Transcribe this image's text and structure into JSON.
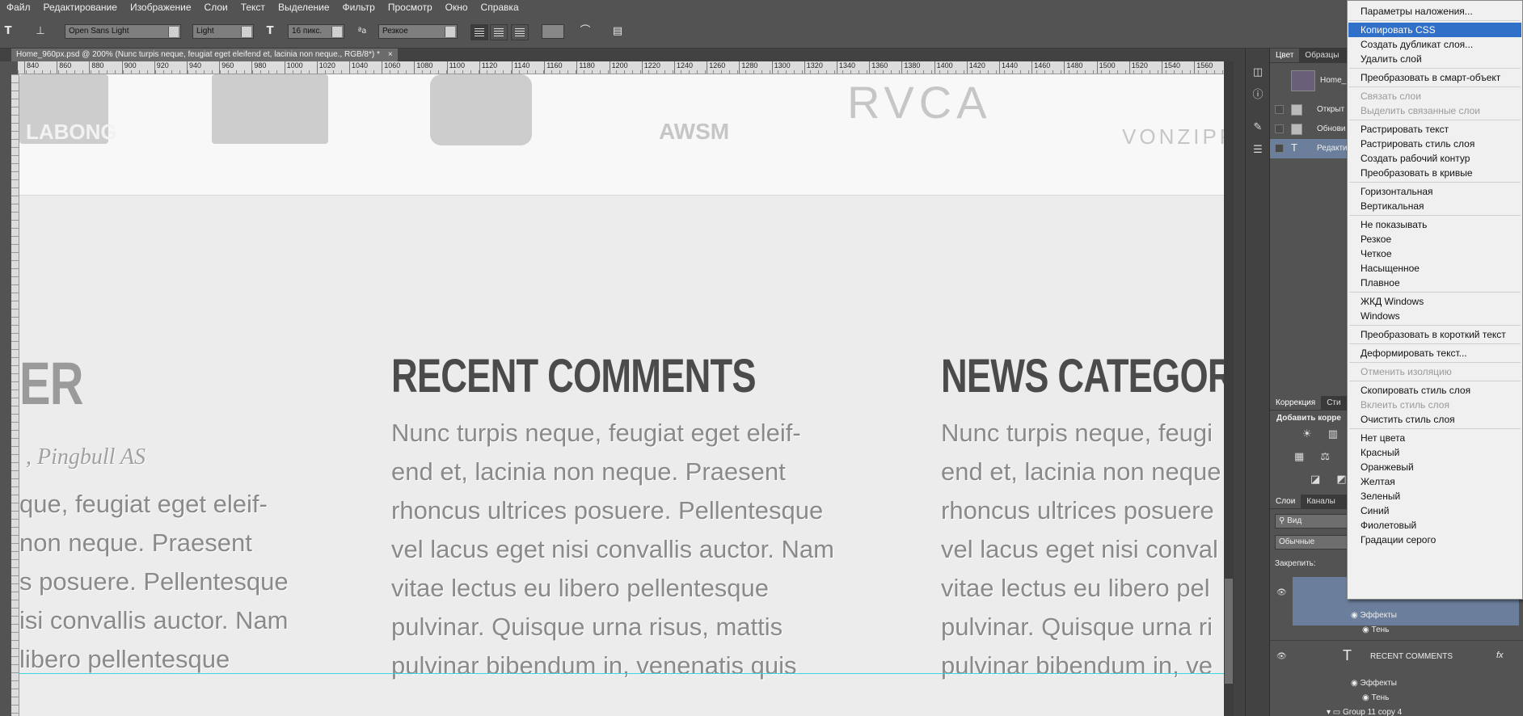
{
  "menu": [
    "Файл",
    "Редактирование",
    "Изображение",
    "Слои",
    "Текст",
    "Выделение",
    "Фильтр",
    "Просмотр",
    "Окно",
    "Справка"
  ],
  "options": {
    "font_family": "Open Sans Light",
    "font_style": "Light",
    "font_size": "16 пикс.",
    "antialias": "Резкое"
  },
  "document_tab": {
    "title": "Home_960px.psd @ 200% (Nunc turpis neque, feugiat eget eleifend et, lacinia non neque., RGB/8*) *",
    "close": "×"
  },
  "ruler": [
    "840",
    "860",
    "880",
    "900",
    "920",
    "940",
    "960",
    "980",
    "1000",
    "1020",
    "1040",
    "1060",
    "1080",
    "1100",
    "1120",
    "1140",
    "1160",
    "1180",
    "1200",
    "1220",
    "1240",
    "1260",
    "1280",
    "1300",
    "1320",
    "1340",
    "1360",
    "1380",
    "1400",
    "1420",
    "1440",
    "1460",
    "1480",
    "1500",
    "1520",
    "1540",
    "1560"
  ],
  "logos": [
    "LABONG",
    "AWSM",
    "RVCA",
    "VONZIPP"
  ],
  "canvas": {
    "col1": {
      "title": "ER",
      "subtitle": ", Pingbull AS",
      "lines": [
        "que, feugiat eget eleif-",
        "non neque. Praesent",
        "s posuere. Pellentesque",
        "isi convallis auctor. Nam",
        "libero pellentesque"
      ]
    },
    "col2": {
      "title": "RECENT COMMENTS",
      "lines": [
        "Nunc turpis neque, feugiat eget eleif-",
        "end et, lacinia non neque. Praesent",
        "rhoncus ultrices posuere. Pellentesque",
        "vel lacus eget nisi convallis auctor. Nam",
        "vitae lectus eu libero pellentesque",
        "pulvinar. Quisque urna risus, mattis",
        "pulvinar bibendum in, venenatis quis"
      ]
    },
    "col3": {
      "title": "NEWS CATEGORIES",
      "lines": [
        "Nunc turpis neque, feugi",
        "end et, lacinia non neque",
        "rhoncus ultrices posuere",
        "vel lacus eget nisi conval",
        "vitae lectus eu libero pel",
        "pulvinar. Quisque urna ri",
        "pulvinar bibendum in, ve"
      ]
    }
  },
  "panels": {
    "top_tabs": [
      "Цвет",
      "Образцы"
    ],
    "history_doc": "Home_",
    "history": [
      "Открыт",
      "Обнови",
      "Редакти"
    ],
    "adj_tabs": [
      "Коррекция",
      "Сти"
    ],
    "adj_title": "Добавить корре",
    "layers_tabs": [
      "Слои",
      "Каналы"
    ],
    "filter": "Вид",
    "blend": "Обычные",
    "lock": "Закрепить:",
    "effects1": "Эффекты",
    "shadow1": "Тень",
    "layer_name": "RECENT COMMENTS",
    "fx": "fx",
    "effects2": "Эффекты",
    "shadow2": "Тень",
    "group": "Group 11 copy 4"
  },
  "context_menu": [
    {
      "label": "Параметры наложения..."
    },
    {
      "sep": true
    },
    {
      "label": "Копировать CSS",
      "hl": true
    },
    {
      "label": "Создать дубликат слоя..."
    },
    {
      "label": "Удалить слой"
    },
    {
      "sep": true
    },
    {
      "label": "Преобразовать в смарт-объект"
    },
    {
      "sep": true
    },
    {
      "label": "Связать слои",
      "dis": true
    },
    {
      "label": "Выделить связанные слои",
      "dis": true
    },
    {
      "sep": true
    },
    {
      "label": "Растрировать текст"
    },
    {
      "label": "Растрировать стиль слоя"
    },
    {
      "label": "Создать рабочий контур"
    },
    {
      "label": "Преобразовать в кривые"
    },
    {
      "sep": true
    },
    {
      "label": "Горизонтальная"
    },
    {
      "label": "Вертикальная"
    },
    {
      "sep": true
    },
    {
      "label": "Не показывать"
    },
    {
      "label": "Резкое"
    },
    {
      "label": "Четкое"
    },
    {
      "label": "Насыщенное"
    },
    {
      "label": "Плавное"
    },
    {
      "sep": true
    },
    {
      "label": "ЖКД Windows"
    },
    {
      "label": "Windows"
    },
    {
      "sep": true
    },
    {
      "label": "Преобразовать в короткий текст"
    },
    {
      "sep": true
    },
    {
      "label": "Деформировать текст..."
    },
    {
      "sep": true
    },
    {
      "label": "Отменить изоляцию",
      "dis": true
    },
    {
      "sep": true
    },
    {
      "label": "Скопировать стиль слоя"
    },
    {
      "label": "Вклеить стиль слоя",
      "dis": true
    },
    {
      "label": "Очистить стиль слоя"
    },
    {
      "sep": true
    },
    {
      "label": "Нет цвета"
    },
    {
      "label": "Красный"
    },
    {
      "label": "Оранжевый"
    },
    {
      "label": "Желтая"
    },
    {
      "label": "Зеленый"
    },
    {
      "label": "Синий"
    },
    {
      "label": "Фиолетовый"
    },
    {
      "label": "Градации серого"
    }
  ]
}
